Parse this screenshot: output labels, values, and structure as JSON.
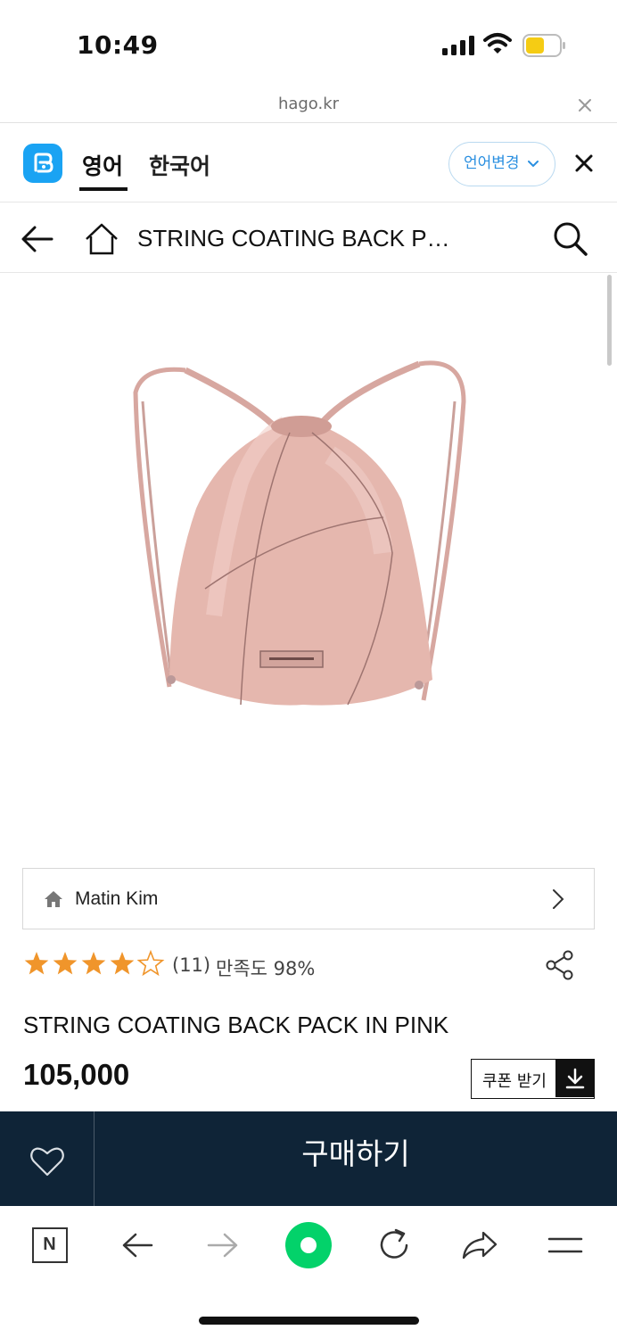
{
  "status_bar": {
    "time": "10:49"
  },
  "url_bar": {
    "domain": "hago.kr"
  },
  "translate_bar": {
    "tab_english": "영어",
    "tab_korean": "한국어",
    "change_language": "언어변경"
  },
  "header": {
    "title": "STRING COATING BACK P…"
  },
  "brand": {
    "name": "Matin Kim"
  },
  "rating": {
    "stars": 4,
    "max_stars": 5,
    "review_count": "(11)",
    "satisfaction": "만족도 98%"
  },
  "product": {
    "name": "STRING COATING BACK PACK IN PINK",
    "price": "105,000",
    "coupon_label": "쿠폰 받기"
  },
  "buy_bar": {
    "buy_label": "구매하기"
  },
  "toolbar": {
    "naver_letter": "N"
  },
  "colors": {
    "buy_bar_bg": "#0f2437",
    "star": "#f0952b",
    "accent_blue": "#2a8fe0",
    "green_button": "#03d26a"
  },
  "icons": [
    "signal-icon",
    "wifi-icon",
    "battery-icon",
    "close-icon",
    "papago-icon",
    "chevron-down-icon",
    "back-icon",
    "home-icon",
    "search-icon",
    "chevron-right-icon",
    "share-icon",
    "download-icon",
    "heart-icon",
    "forward-icon",
    "refresh-icon",
    "share-arrow-icon",
    "menu-icon"
  ]
}
